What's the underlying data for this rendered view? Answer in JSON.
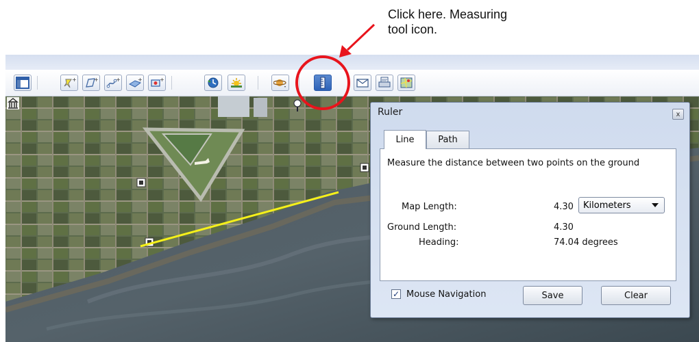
{
  "annotation": {
    "text_line1": "Click here. Measuring",
    "text_line2": "tool icon."
  },
  "toolbar": {
    "buttons": [
      {
        "name": "sidebar-icon"
      },
      {
        "name": "placemark-icon"
      },
      {
        "name": "polygon-icon"
      },
      {
        "name": "path-icon"
      },
      {
        "name": "image-overlay-icon"
      },
      {
        "name": "record-tour-icon"
      },
      {
        "name": "historical-imagery-icon"
      },
      {
        "name": "sunlight-icon"
      },
      {
        "name": "planets-icon"
      },
      {
        "name": "ruler-icon"
      },
      {
        "name": "email-icon"
      },
      {
        "name": "print-icon"
      },
      {
        "name": "google-maps-icon"
      }
    ]
  },
  "ruler": {
    "title": "Ruler",
    "close_label": "x",
    "tabs": [
      {
        "label": "Line",
        "active": true
      },
      {
        "label": "Path",
        "active": false
      }
    ],
    "description": "Measure the distance between two points on the ground",
    "map_length_label": "Map Length:",
    "map_length_value": "4.30",
    "unit": "Kilometers",
    "ground_length_label": "Ground Length:",
    "ground_length_value": "4.30",
    "heading_label": "Heading:",
    "heading_value": "74.04 degrees",
    "mouse_navigation_label": "Mouse Navigation",
    "mouse_navigation_checked": true,
    "checkbox_mark": "✓",
    "save_label": "Save",
    "clear_label": "Clear"
  },
  "colors": {
    "measure_line": "#f5f01a",
    "annotation_red": "#e8141c",
    "toolbar_active": "#2d62b8"
  }
}
